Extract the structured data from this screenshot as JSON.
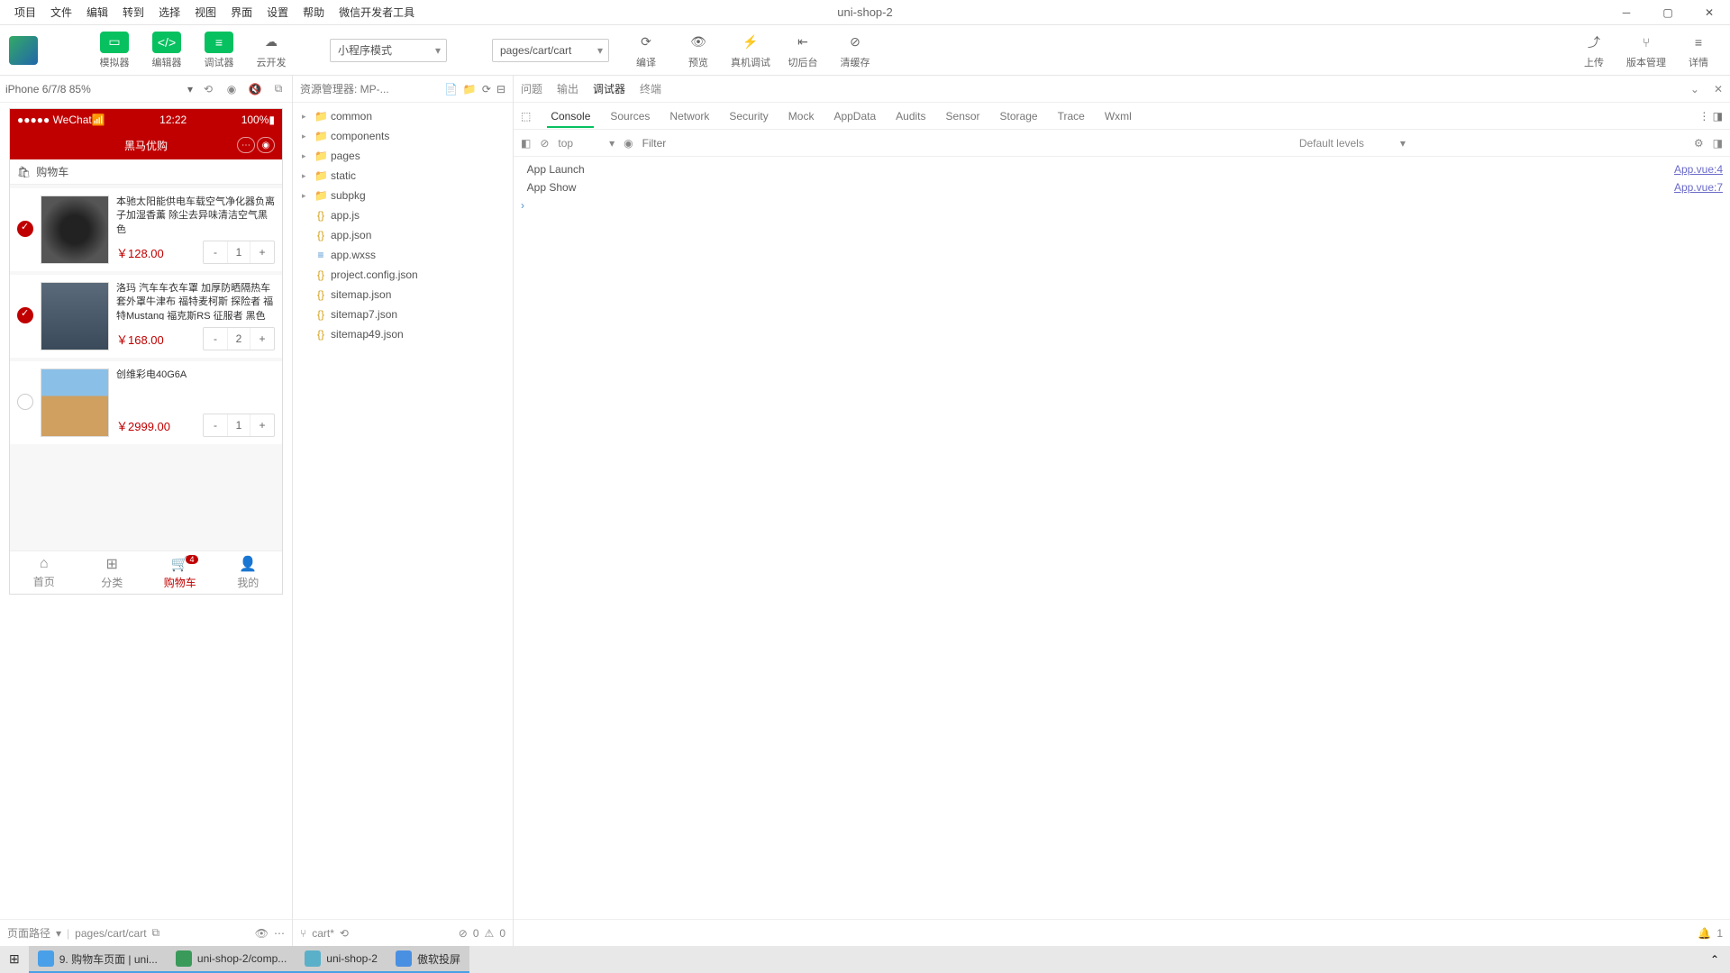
{
  "window": {
    "title": "uni-shop-2"
  },
  "menu": [
    "项目",
    "文件",
    "编辑",
    "转到",
    "选择",
    "视图",
    "界面",
    "设置",
    "帮助",
    "微信开发者工具"
  ],
  "toolbar": {
    "sim": "模拟器",
    "edit": "编辑器",
    "dbg": "调试器",
    "cloud": "云开发",
    "mode": "小程序模式",
    "page": "pages/cart/cart",
    "compile": "编译",
    "preview": "预览",
    "remote": "真机调试",
    "back": "切后台",
    "clear": "清缓存",
    "upload": "上传",
    "ver": "版本管理",
    "detail": "详情"
  },
  "sim": {
    "device": "iPhone 6/7/8 85%",
    "path_lbl": "页面路径",
    "path": "pages/cart/cart",
    "status": {
      "carrier": "●●●●● WeChat",
      "signal": "󰀂",
      "time": "12:22",
      "batt": "100%"
    },
    "nav": "黑马优购",
    "sub_icon": "🛒",
    "sub": "购物车",
    "items": [
      {
        "checked": true,
        "name": "本驰太阳能供电车载空气净化器负离子加湿香薰 除尘去异味清洁空气黑色",
        "price": "￥128.00",
        "qty": 1
      },
      {
        "checked": true,
        "name": "洛玛 汽车车衣车罩 加厚防晒隔热车套外罩牛津布 福特麦柯斯 探险者 福特Mustang 福克斯RS 征服者 黑色",
        "price": "￥168.00",
        "qty": 2
      },
      {
        "checked": false,
        "name": "创维彩电40G6A",
        "price": "￥2999.00",
        "qty": 1
      }
    ],
    "tabs": [
      {
        "l": "首页"
      },
      {
        "l": "分类"
      },
      {
        "l": "购物车",
        "badge": "4",
        "act": true
      },
      {
        "l": "我的"
      }
    ]
  },
  "files": {
    "hdr": "资源管理器: MP-...",
    "tree": [
      {
        "t": "folder",
        "n": "common"
      },
      {
        "t": "folder pkg",
        "n": "components"
      },
      {
        "t": "folder pkg",
        "n": "pages"
      },
      {
        "t": "folder",
        "n": "static"
      },
      {
        "t": "folder pkg",
        "n": "subpkg"
      },
      {
        "t": "js",
        "n": "app.js"
      },
      {
        "t": "json",
        "n": "app.json"
      },
      {
        "t": "wxss",
        "n": "app.wxss"
      },
      {
        "t": "json",
        "n": "project.config.json"
      },
      {
        "t": "json",
        "n": "sitemap.json"
      },
      {
        "t": "json",
        "n": "sitemap7.json"
      },
      {
        "t": "json",
        "n": "sitemap49.json"
      }
    ],
    "status": {
      "file": "cart*",
      "err": "0",
      "warn": "0"
    }
  },
  "dev": {
    "top": [
      "问题",
      "输出",
      "调试器",
      "终端"
    ],
    "top_act": 2,
    "tabs": [
      "Console",
      "Sources",
      "Network",
      "Security",
      "Mock",
      "AppData",
      "Audits",
      "Sensor",
      "Storage",
      "Trace",
      "Wxml"
    ],
    "tabs_act": 0,
    "filter": {
      "ctx": "top",
      "ph": "Filter",
      "lvl": "Default levels"
    },
    "log": [
      {
        "msg": "App Launch",
        "src": "App.vue:4"
      },
      {
        "msg": "App Show",
        "src": "App.vue:7"
      }
    ],
    "right": {
      "count": "1"
    }
  },
  "taskbar": [
    {
      "l": "",
      "win": true
    },
    {
      "l": "9. 购物车页面 | uni...",
      "c": "#4aa0e8"
    },
    {
      "l": "uni-shop-2/comp...",
      "c": "#3a9a5a"
    },
    {
      "l": "uni-shop-2",
      "c": "#5ab0c8"
    },
    {
      "l": "傲软投屏",
      "c": "#4a90e2"
    }
  ]
}
